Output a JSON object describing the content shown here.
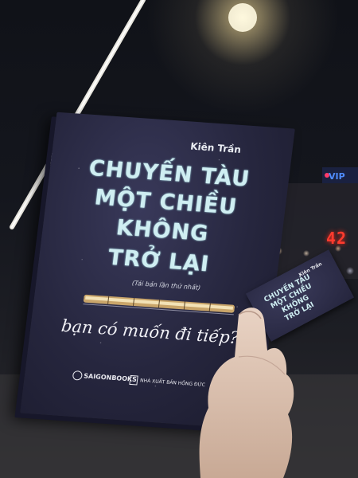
{
  "book": {
    "author": "Kiên Trần",
    "title_lines": [
      "CHUYẾN TÀU",
      "MỘT CHIỀU",
      "KHÔNG",
      "TRỞ LẠI"
    ],
    "edition": "(Tái bản lần thứ nhất)",
    "tagline": "bạn có muốn đi tiếp?",
    "publisher_1": "SAIGONBOOKS",
    "publisher_2": "NHÀ XUẤT BẢN HỒNG ĐỨC"
  },
  "bookmark": {
    "author": "Kiên Trần",
    "title_lines": [
      "CHUYẾN TÀU",
      "MỘT CHIỀU",
      "KHÔNG",
      "TRỞ LẠI"
    ]
  },
  "background": {
    "counter": "42",
    "sign": "VIP"
  },
  "colors": {
    "cover": "#26263e",
    "title_text": "#cfeef2",
    "counter_red": "#ff3b2e"
  }
}
